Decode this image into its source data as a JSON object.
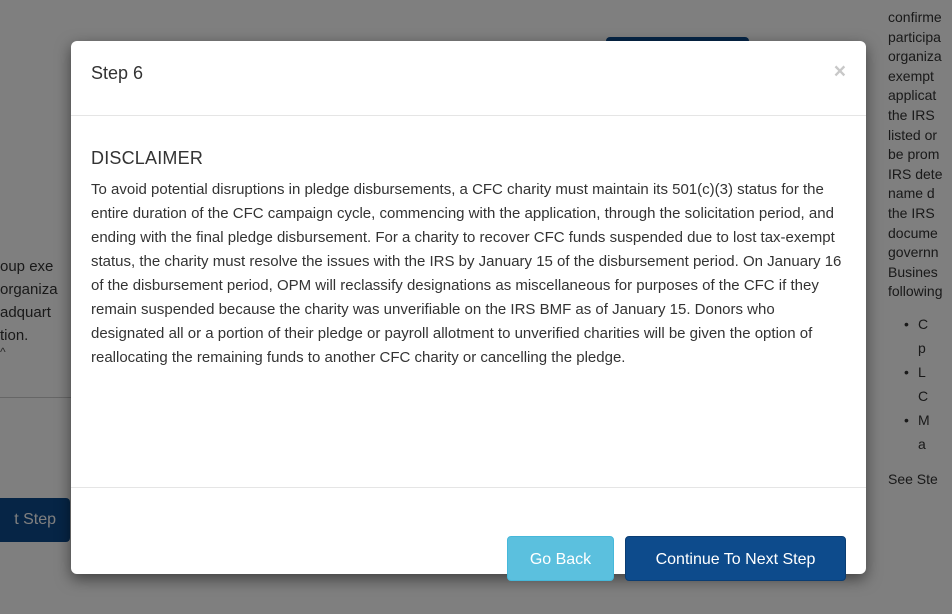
{
  "background": {
    "left_text_lines": [
      "oup exe",
      "organiza",
      "adquart",
      "tion."
    ],
    "left_caret": "^",
    "left_button_label": "t Step",
    "right_text_lines": [
      "confirme",
      "participa",
      "organiza",
      "exempt",
      "applicat",
      "the IRS",
      "listed or",
      "be prom",
      "IRS dete",
      "name d",
      "the IRS",
      "docume",
      "governn",
      "Busines",
      "following"
    ],
    "right_list_items": [
      "C",
      "p",
      "L",
      "C",
      "M",
      "a"
    ],
    "right_footer": "See Ste"
  },
  "modal": {
    "title": "Step 6",
    "close_symbol": "×",
    "heading": "DISCLAIMER",
    "body": "To avoid potential disruptions in pledge disbursements, a CFC charity must maintain its 501(c)(3) status for the entire duration of the CFC campaign cycle, commencing with the application, through the solicitation period, and ending with the final pledge disbursement. For a charity to recover CFC funds suspended due to lost tax-exempt status, the charity must resolve the issues with the IRS by January 15 of the disbursement period. On January 16 of the disbursement period, OPM will reclassify designations as miscellaneous for purposes of the CFC if they remain suspended because the charity was unverifiable on the IRS BMF as of January 15. Donors who designated all or a portion of their pledge or payroll allotment to unverified charities will be given the option of reallocating the remaining funds to another CFC charity or cancelling the pledge.",
    "go_back_label": "Go Back",
    "continue_label": "Continue To Next Step"
  },
  "colors": {
    "primary": "#0d4b8c",
    "info": "#5bc0de"
  }
}
